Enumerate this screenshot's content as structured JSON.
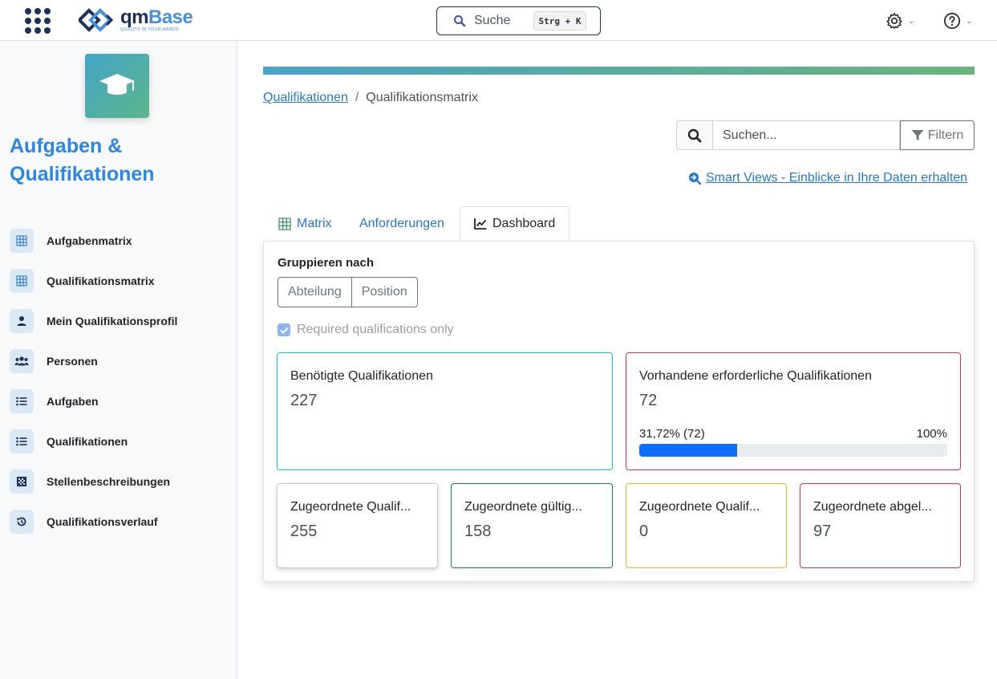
{
  "topbar": {
    "logo_name_a": "qm",
    "logo_name_b": "Base",
    "logo_tagline": "QUALITY IN YOUR HANDS",
    "search_label": "Suche",
    "search_shortcut": "Strg + K",
    "settings_icon": "gear-icon",
    "help_icon": "question-circle-icon"
  },
  "sidebar": {
    "module_icon": "graduation-cap-icon",
    "module_title": "Aufgaben & Qualifikationen",
    "items": [
      {
        "label": "Aufgabenmatrix",
        "icon": "grid-icon"
      },
      {
        "label": "Qualifikationsmatrix",
        "icon": "grid-icon"
      },
      {
        "label": "Mein Qualifikationsprofil",
        "icon": "user-icon"
      },
      {
        "label": "Personen",
        "icon": "users-icon"
      },
      {
        "label": "Aufgaben",
        "icon": "list-icon"
      },
      {
        "label": "Qualifikationen",
        "icon": "list-icon"
      },
      {
        "label": "Stellenbeschreibungen",
        "icon": "checkered-icon"
      },
      {
        "label": "Qualifikationsverlauf",
        "icon": "history-icon"
      }
    ]
  },
  "breadcrumb": {
    "parent": "Qualifikationen",
    "separator": "/",
    "current": "Qualifikationsmatrix"
  },
  "search": {
    "placeholder": "Suchen...",
    "filter_label": "Filtern"
  },
  "smart_views_link": "Smart Views - Einblicke in Ihre Daten erhalten",
  "tabs": [
    {
      "label": "Matrix",
      "active": false
    },
    {
      "label": "Anforderungen",
      "active": false
    },
    {
      "label": "Dashboard",
      "active": true
    }
  ],
  "dashboard": {
    "group_by_label": "Gruppieren nach",
    "group_options": [
      "Abteilung",
      "Position"
    ],
    "required_only_label": "Required qualifications only",
    "required_only_checked": true,
    "cards": {
      "needed": {
        "title": "Benötigte Qualifikationen",
        "value": "227",
        "border": "#17c1d6"
      },
      "existing": {
        "title": "Vorhandene erforderliche Qualifikationen",
        "value": "72",
        "border": "#c9364a",
        "progress_label": "31,72% (72)",
        "progress_max_label": "100%",
        "progress_fraction": 0.3172
      },
      "assigned": {
        "title": "Zugeordnete Qualif...",
        "value": "255",
        "border": "#c6c9cc"
      },
      "valid": {
        "title": "Zugeordnete gültig...",
        "value": "158",
        "border": "#1a7a5e"
      },
      "expiring": {
        "title": "Zugeordnete Qualif...",
        "value": "0",
        "border": "#f0b429"
      },
      "expired": {
        "title": "Zugeordnete abgel...",
        "value": "97",
        "border": "#c9364a"
      }
    },
    "accent_color": "#0d6efd"
  }
}
